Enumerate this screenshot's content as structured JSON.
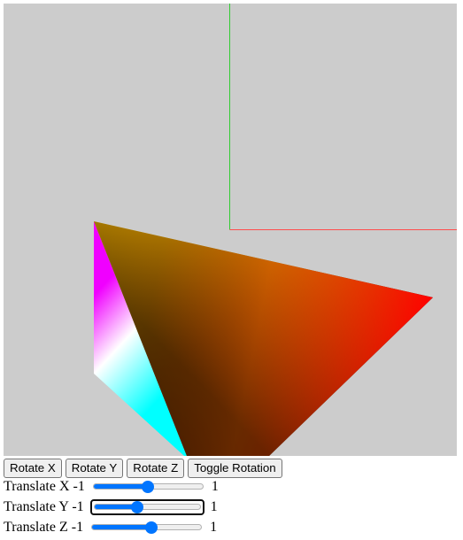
{
  "controls": {
    "rotate_x_label": "Rotate X",
    "rotate_y_label": "Rotate Y",
    "rotate_z_label": "Rotate Z",
    "toggle_rotation_label": "Toggle Rotation"
  },
  "sliders": [
    {
      "label": "Translate X -1",
      "max_label": "1",
      "min": -1,
      "max": 1,
      "value": 0.0,
      "focused": false
    },
    {
      "label": "Translate Y -1",
      "max_label": "1",
      "min": -1,
      "max": 1,
      "value": -0.2,
      "focused": true
    },
    {
      "label": "Translate Z -1",
      "max_label": "1",
      "min": -1,
      "max": 1,
      "value": 0.1,
      "focused": false
    }
  ],
  "scene": {
    "background_color": "#cccccc",
    "x_axis_color": "#ff4d4d",
    "y_axis_color": "#33cc33"
  }
}
